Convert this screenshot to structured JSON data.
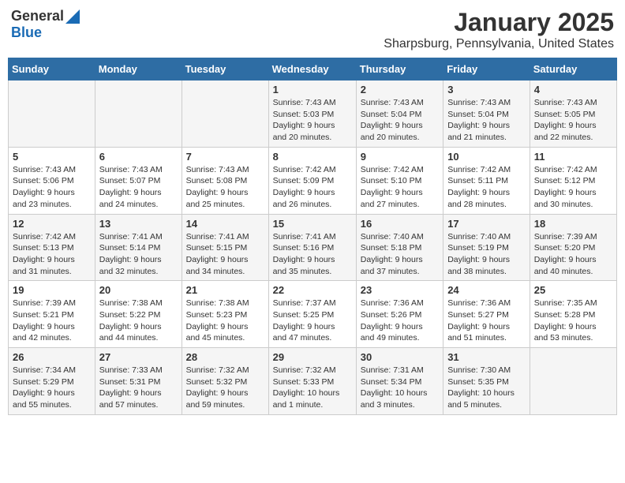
{
  "header": {
    "logo_general": "General",
    "logo_blue": "Blue",
    "title": "January 2025",
    "location": "Sharpsburg, Pennsylvania, United States"
  },
  "days_of_week": [
    "Sunday",
    "Monday",
    "Tuesday",
    "Wednesday",
    "Thursday",
    "Friday",
    "Saturday"
  ],
  "weeks": [
    [
      {
        "day": "",
        "info": ""
      },
      {
        "day": "",
        "info": ""
      },
      {
        "day": "",
        "info": ""
      },
      {
        "day": "1",
        "info": "Sunrise: 7:43 AM\nSunset: 5:03 PM\nDaylight: 9 hours\nand 20 minutes."
      },
      {
        "day": "2",
        "info": "Sunrise: 7:43 AM\nSunset: 5:04 PM\nDaylight: 9 hours\nand 20 minutes."
      },
      {
        "day": "3",
        "info": "Sunrise: 7:43 AM\nSunset: 5:04 PM\nDaylight: 9 hours\nand 21 minutes."
      },
      {
        "day": "4",
        "info": "Sunrise: 7:43 AM\nSunset: 5:05 PM\nDaylight: 9 hours\nand 22 minutes."
      }
    ],
    [
      {
        "day": "5",
        "info": "Sunrise: 7:43 AM\nSunset: 5:06 PM\nDaylight: 9 hours\nand 23 minutes."
      },
      {
        "day": "6",
        "info": "Sunrise: 7:43 AM\nSunset: 5:07 PM\nDaylight: 9 hours\nand 24 minutes."
      },
      {
        "day": "7",
        "info": "Sunrise: 7:43 AM\nSunset: 5:08 PM\nDaylight: 9 hours\nand 25 minutes."
      },
      {
        "day": "8",
        "info": "Sunrise: 7:42 AM\nSunset: 5:09 PM\nDaylight: 9 hours\nand 26 minutes."
      },
      {
        "day": "9",
        "info": "Sunrise: 7:42 AM\nSunset: 5:10 PM\nDaylight: 9 hours\nand 27 minutes."
      },
      {
        "day": "10",
        "info": "Sunrise: 7:42 AM\nSunset: 5:11 PM\nDaylight: 9 hours\nand 28 minutes."
      },
      {
        "day": "11",
        "info": "Sunrise: 7:42 AM\nSunset: 5:12 PM\nDaylight: 9 hours\nand 30 minutes."
      }
    ],
    [
      {
        "day": "12",
        "info": "Sunrise: 7:42 AM\nSunset: 5:13 PM\nDaylight: 9 hours\nand 31 minutes."
      },
      {
        "day": "13",
        "info": "Sunrise: 7:41 AM\nSunset: 5:14 PM\nDaylight: 9 hours\nand 32 minutes."
      },
      {
        "day": "14",
        "info": "Sunrise: 7:41 AM\nSunset: 5:15 PM\nDaylight: 9 hours\nand 34 minutes."
      },
      {
        "day": "15",
        "info": "Sunrise: 7:41 AM\nSunset: 5:16 PM\nDaylight: 9 hours\nand 35 minutes."
      },
      {
        "day": "16",
        "info": "Sunrise: 7:40 AM\nSunset: 5:18 PM\nDaylight: 9 hours\nand 37 minutes."
      },
      {
        "day": "17",
        "info": "Sunrise: 7:40 AM\nSunset: 5:19 PM\nDaylight: 9 hours\nand 38 minutes."
      },
      {
        "day": "18",
        "info": "Sunrise: 7:39 AM\nSunset: 5:20 PM\nDaylight: 9 hours\nand 40 minutes."
      }
    ],
    [
      {
        "day": "19",
        "info": "Sunrise: 7:39 AM\nSunset: 5:21 PM\nDaylight: 9 hours\nand 42 minutes."
      },
      {
        "day": "20",
        "info": "Sunrise: 7:38 AM\nSunset: 5:22 PM\nDaylight: 9 hours\nand 44 minutes."
      },
      {
        "day": "21",
        "info": "Sunrise: 7:38 AM\nSunset: 5:23 PM\nDaylight: 9 hours\nand 45 minutes."
      },
      {
        "day": "22",
        "info": "Sunrise: 7:37 AM\nSunset: 5:25 PM\nDaylight: 9 hours\nand 47 minutes."
      },
      {
        "day": "23",
        "info": "Sunrise: 7:36 AM\nSunset: 5:26 PM\nDaylight: 9 hours\nand 49 minutes."
      },
      {
        "day": "24",
        "info": "Sunrise: 7:36 AM\nSunset: 5:27 PM\nDaylight: 9 hours\nand 51 minutes."
      },
      {
        "day": "25",
        "info": "Sunrise: 7:35 AM\nSunset: 5:28 PM\nDaylight: 9 hours\nand 53 minutes."
      }
    ],
    [
      {
        "day": "26",
        "info": "Sunrise: 7:34 AM\nSunset: 5:29 PM\nDaylight: 9 hours\nand 55 minutes."
      },
      {
        "day": "27",
        "info": "Sunrise: 7:33 AM\nSunset: 5:31 PM\nDaylight: 9 hours\nand 57 minutes."
      },
      {
        "day": "28",
        "info": "Sunrise: 7:32 AM\nSunset: 5:32 PM\nDaylight: 9 hours\nand 59 minutes."
      },
      {
        "day": "29",
        "info": "Sunrise: 7:32 AM\nSunset: 5:33 PM\nDaylight: 10 hours\nand 1 minute."
      },
      {
        "day": "30",
        "info": "Sunrise: 7:31 AM\nSunset: 5:34 PM\nDaylight: 10 hours\nand 3 minutes."
      },
      {
        "day": "31",
        "info": "Sunrise: 7:30 AM\nSunset: 5:35 PM\nDaylight: 10 hours\nand 5 minutes."
      },
      {
        "day": "",
        "info": ""
      }
    ]
  ]
}
